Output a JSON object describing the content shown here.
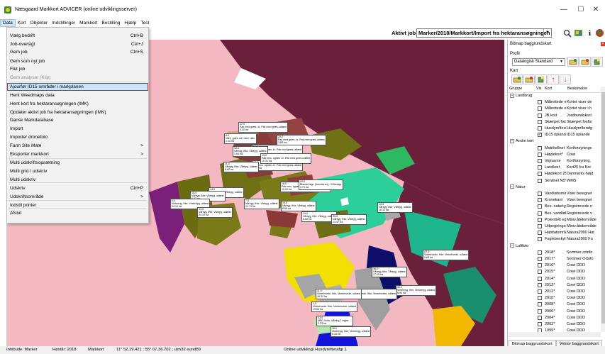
{
  "app": {
    "title": "Næsgaard Markkort ADVICER (online udviklingsserver)",
    "window_controls": [
      "—",
      "☐",
      "✕"
    ]
  },
  "menubar": [
    "Data",
    "Kort",
    "Objekter",
    "Indstillinger",
    "Markkort",
    "Bestilling",
    "Hjælp",
    "Test"
  ],
  "toolbar": {
    "aktiv_job_label": "Aktivt job",
    "aktiv_job_value": "Marker/2018/Markkort/Import fra hektaransøgningen",
    "icons": [
      "zoom-icon",
      "map-icon",
      "info-icon",
      "globe-icon"
    ]
  },
  "data_menu": [
    {
      "label": "Vælg bedrift",
      "shortcut": "Ctrl+B"
    },
    {
      "label": "Job-oversigt",
      "shortcut": "Ctrl+J"
    },
    {
      "label": "Gem job",
      "shortcut": "Ctrl+S"
    },
    {
      "label": "Gem som nyt job",
      "shortcut": ""
    },
    {
      "label": "Flet job",
      "shortcut": ""
    },
    {
      "label": "Gem analyser (Klip)",
      "shortcut": "",
      "disabled": true
    },
    {
      "label": "Ajourfør ID15 områder i markplanen",
      "shortcut": "",
      "highlighted": true
    },
    {
      "label": "Hent Weedmaps data",
      "shortcut": ""
    },
    {
      "label": "Hent kort fra hektaransøgningen (IMK)",
      "shortcut": ""
    },
    {
      "label": "Opdater aktivt job fra hektaransøgningen (IMK)",
      "shortcut": ""
    },
    {
      "label": "Dansk Markdatabase",
      "shortcut": ""
    },
    {
      "label": "Import",
      "shortcut": ""
    },
    {
      "label": "Importer dronefoto",
      "shortcut": ""
    },
    {
      "label": "Farm Site Mate",
      "shortcut": ">"
    },
    {
      "label": "Eksporter markkort",
      "shortcut": ">"
    },
    {
      "label": "Multi udskriftsopsætning",
      "shortcut": ""
    },
    {
      "label": "Multi grid / udskriv",
      "shortcut": ""
    },
    {
      "label": "Multi udskriv",
      "shortcut": ""
    },
    {
      "label": "Udskriv",
      "shortcut": "Ctrl+P"
    },
    {
      "label": "Udskriftsområde",
      "shortcut": ">"
    },
    {
      "label": "Indstil printer",
      "shortcut": ""
    },
    {
      "label": "Afslut",
      "shortcut": ""
    }
  ],
  "map_labels": [
    "17-0\nPak med græs -fx. Pak med græs-udlæst\n0.00 ha",
    "8-0\nVårb. græs udl. med. udb.\n1.44 ha",
    "10-0\nPak mxs. ngræs -fx. Pak med græs-udlæst\n1.69 ha",
    "16-0\nVårbyg, fhbr, Vårbyg, udlæst\n1.64 ha",
    "20-0\nPak med græs -fx. Pak med græs-udlæst\n3.69 ha",
    "12-0\nPak mxs. ngræs -fx. Pak med græs-udlæst\n2.22 ha",
    "13-0\nPak mxs. ngræs -fx. Pak med græs-udlæst\n10.31 ha",
    "11-0\nVårbyg, fhbr, Vårbyg, udlæst\n8.62 ha",
    "14-0\nVårbyg, fhbr, Vårbyg, udlæst\n11.68 ha",
    "15-0\nVårbyg, fhbr, Vårbyg, udlæst\n6.42 ha",
    "18-0\nPak mxs. ngræs -fx. Pak med græs-udlæst\n10.00 ha",
    "7-0\nVårbyg, fhbr, Vårbyg, udlæst\n13.73 ha",
    "6-0\nVinterrug, fhbr, Vinterbyg, udlæst\n24.10 ha",
    "13-0\nVårbyg, fhbr, Vårbyg, udlæst\n24.19 ha",
    "19-0\nVårbyg, fhbr, Vårbyg, udlæst\n8.69 ha",
    "20-0\nBlandet afgr. (korn/ærter) + Efterafgr.\n3.71 ha",
    "19-0\nVårbyg, fhbr, Vårbyg, udlæst\n8.63 ha",
    "30-0\nVårbyg, fhbr, Vårbyg, udlæst\n13.47 ha",
    "10-0\nVårbyg, fhbr, Vårbyg, udlæst\n16.12 ha",
    "47-0\nVinterhvede, fhbr, Vinterhvede, udlæst\n4.63 ha",
    "36-0\nVårbyg, fhbr, Vårbyg, udlæst\n17.05 ha",
    "36-0\nVinterbyg, fhbr, Vinterbyg, udlæst\n8.95 ha",
    "34-0\nVinterhvede, fhbr, Vinterhvede, udlæst\n7.55 ha",
    "11-0\nVinterhvede, fhbr, Vinterhvede, udlæst\n16.32 ha",
    "1-0\nVinterhvede, fhbr, Vinterhvede, udlæst\n19.66 ha",
    "43-0\nMED Vinrk, slåning 1 mgter ...\n2.23 ha",
    "16-0\nVinterbyg, fhbr, Vinterbyg, udlæst\n5.34 ha"
  ],
  "panel": {
    "title": "Bitmap baggrundskort",
    "profil_label": "Profil",
    "profil_value": "Datalogisk Standard",
    "kort_label": "Kort",
    "columns": [
      "Gruppe",
      "Vis",
      "Kort",
      "Beskrivelse"
    ],
    "rows": [
      {
        "group": "Landbrug",
        "is_group": true
      },
      {
        "checked": false,
        "name": "Målrettede ef",
        "desc": "Kortet viser de"
      },
      {
        "checked": false,
        "name": "Målrettede ef",
        "desc": "Kortet viser i h"
      },
      {
        "checked": false,
        "name": "JB kort",
        "desc": "Jordbundskort"
      },
      {
        "checked": false,
        "name": "Skærpet fosfo",
        "desc": "Skærpet fosfor"
      },
      {
        "checked": false,
        "name": "Husdyrefterafg",
        "desc": "Husdyrefterafg"
      },
      {
        "checked": true,
        "name": "ID15 oplande",
        "desc": "ID15 oplande"
      },
      {
        "group": "Andre kort",
        "is_group": true
      },
      {
        "checked": false,
        "name": "Matrikelkort",
        "desc": "Kortforsyninge"
      },
      {
        "checked": false,
        "name": "Højdekort*",
        "desc": "Cowi"
      },
      {
        "checked": false,
        "name": "Vejnavne",
        "desc": "Kortforsyning,"
      },
      {
        "checked": false,
        "name": "Landkort",
        "desc": "Kort25 fra Kor"
      },
      {
        "checked": false,
        "name": "Højdekort 25",
        "desc": "Danmarks højd"
      },
      {
        "checked": false,
        "name": "Sentinel NDW",
        "desc": "WMS"
      },
      {
        "group": "Natur",
        "is_group": true
      },
      {
        "checked": false,
        "name": "Vandløbsmidt",
        "desc": "Viser beregnet"
      },
      {
        "checked": false,
        "name": "Kronekant",
        "desc": "Viser beregnet"
      },
      {
        "checked": false,
        "name": "Bes. naturtyp",
        "desc": "Registrerede n"
      },
      {
        "checked": false,
        "name": "Bes. vandløb",
        "desc": "Registrerede v"
      },
      {
        "checked": false,
        "name": "Potentielt egr",
        "desc": "Miniv.åbdområde"
      },
      {
        "checked": false,
        "name": "Udpegningsgr",
        "desc": "Miniv.åbdområde"
      },
      {
        "checked": false,
        "name": "Habitatområd",
        "desc": "Natura2000 Hat"
      },
      {
        "checked": false,
        "name": "Fuglebeskytt",
        "desc": "Natura2000 Fu"
      },
      {
        "group": "Luftfoto",
        "is_group": true
      },
      {
        "checked": false,
        "name": "2018*",
        "desc": "Sommer ortofo"
      },
      {
        "checked": false,
        "name": "2017*",
        "desc": "Sommer Ortofo"
      },
      {
        "checked": false,
        "name": "2016*",
        "desc": "Cowi DDO"
      },
      {
        "checked": false,
        "name": "2015*",
        "desc": "Cowi DDO"
      },
      {
        "checked": false,
        "name": "2014*",
        "desc": "Cowi DDO"
      },
      {
        "checked": false,
        "name": "2013*",
        "desc": "Cowi DDO"
      },
      {
        "checked": false,
        "name": "2012*",
        "desc": "Cowi DDO"
      },
      {
        "checked": false,
        "name": "2010*",
        "desc": "Cowi DDO"
      },
      {
        "checked": false,
        "name": "2008*",
        "desc": "Cowi DDO"
      },
      {
        "checked": false,
        "name": "2006*",
        "desc": "Cowi DDO"
      },
      {
        "checked": false,
        "name": "2004*",
        "desc": "Cowi DDO"
      },
      {
        "checked": false,
        "name": "2002*",
        "desc": "Cowi DDO"
      },
      {
        "checked": false,
        "name": "1999*",
        "desc": "Cowi DDO"
      }
    ],
    "tabs": [
      "Bitmap baggrundskort",
      "Vektor baggrundskort"
    ]
  },
  "status": {
    "mode": "Inhibude: Marker",
    "year": "Høstår: 2018",
    "layer": "Markkort",
    "coords": "11° 52,19.421 ; 55° 07,36.702 ; utm32 euref89",
    "info": "Online udvikling/ Husdyrefterafgr 1"
  },
  "colors": {
    "map_bg": "#f4b8c2",
    "sea": "#6a1f3a",
    "highlight": "#cde3f7",
    "highlight_border": "#dd2222"
  }
}
